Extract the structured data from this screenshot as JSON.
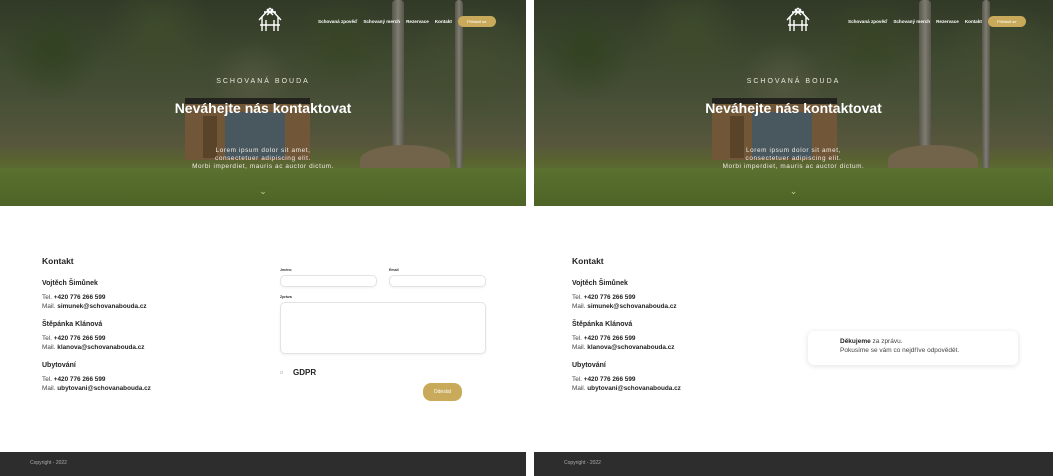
{
  "site": {
    "brand_kicker": "SCHOVANÁ BOUDA",
    "hero_heading": "Neváhejte nás kontaktovat",
    "hero_lead": [
      "Lorem ipsum dolor sit amet,",
      "consectetuer adipiscing elit.",
      "Morbi imperdiet, mauris ac auctor dictum."
    ],
    "nav": [
      "Schovaná zpověď",
      "Schovaný merch",
      "Rezervace",
      "Kontakt"
    ],
    "nav_cta": "Přihlásit se",
    "logo_icon": "hut-logo-icon",
    "scroll_icon": "chevron-down-icon",
    "accent": "#c9aa5a",
    "footer_text": "Copyright - 2022"
  },
  "contact": {
    "title": "Kontakt",
    "people": [
      {
        "name": "Vojtěch Šimůnek",
        "tel_label": "Tel.",
        "tel": "+420 776 266 599",
        "mail_label": "Mail.",
        "mail": "simunek@schovanabouda.cz"
      },
      {
        "name": "Štěpánka Klánová",
        "tel_label": "Tel.",
        "tel": "+420 776 266 599",
        "mail_label": "Mail.",
        "mail": "klanova@schovanabouda.cz"
      },
      {
        "name": "Ubytování",
        "tel_label": "Tel.",
        "tel": "+420 776 266 599",
        "mail_label": "Mail.",
        "mail": "ubytovani@schovanabouda.cz"
      }
    ]
  },
  "form": {
    "name_label": "Jméno",
    "email_label": "Email",
    "message_label": "Zpráva",
    "name_value": "",
    "email_value": "",
    "message_value": "",
    "gdpr_label": "GDPR",
    "gdpr_checked": false,
    "submit_label": "Odeslat"
  },
  "thanks": {
    "bold": "Děkujeme",
    "rest": " za zprávu.",
    "line2": "Pokusíme se vám co nejdříve odpovědět."
  }
}
